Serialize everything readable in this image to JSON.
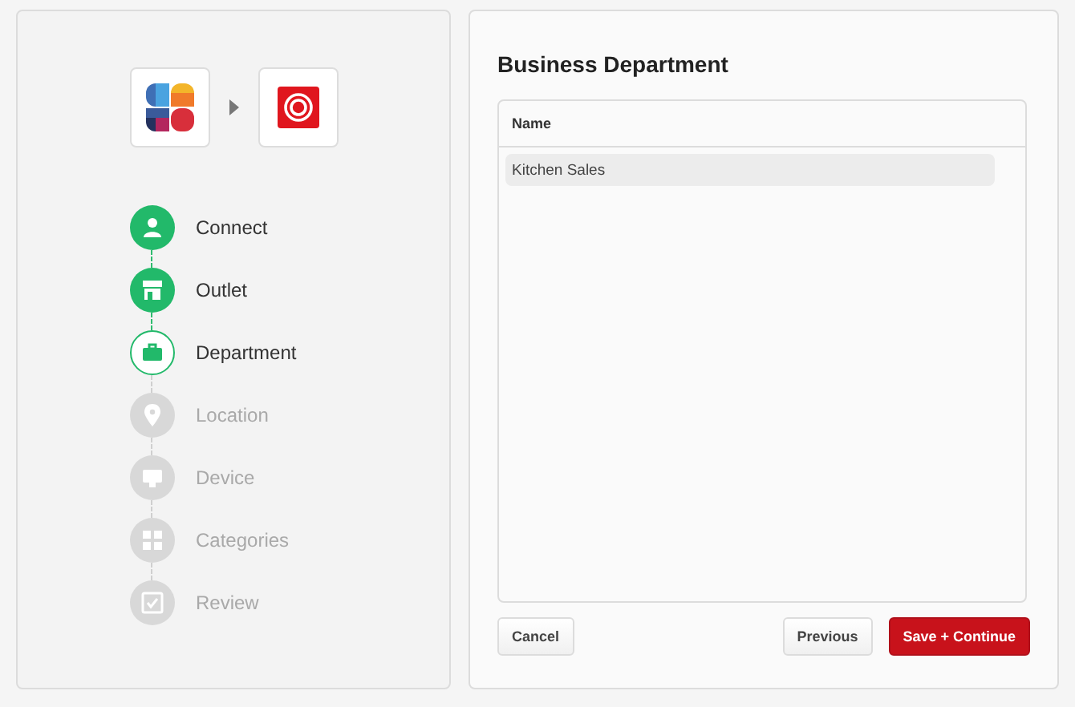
{
  "steps": [
    {
      "label": "Connect",
      "completed": true,
      "active": false
    },
    {
      "label": "Outlet",
      "completed": true,
      "active": false
    },
    {
      "label": "Department",
      "completed": false,
      "active": true
    },
    {
      "label": "Location",
      "completed": false,
      "active": false
    },
    {
      "label": "Device",
      "completed": false,
      "active": false
    },
    {
      "label": "Categories",
      "completed": false,
      "active": false
    },
    {
      "label": "Review",
      "completed": false,
      "active": false
    }
  ],
  "panel": {
    "title": "Business Department",
    "table": {
      "columns": [
        "Name"
      ],
      "rows": [
        {
          "name": "Kitchen Sales",
          "selected": true
        }
      ]
    },
    "buttons": [
      {
        "label": "Cancel",
        "kind": "plain"
      },
      {
        "label": "Previous",
        "kind": "plain"
      },
      {
        "label": "Save + Continue",
        "kind": "primary"
      }
    ]
  }
}
